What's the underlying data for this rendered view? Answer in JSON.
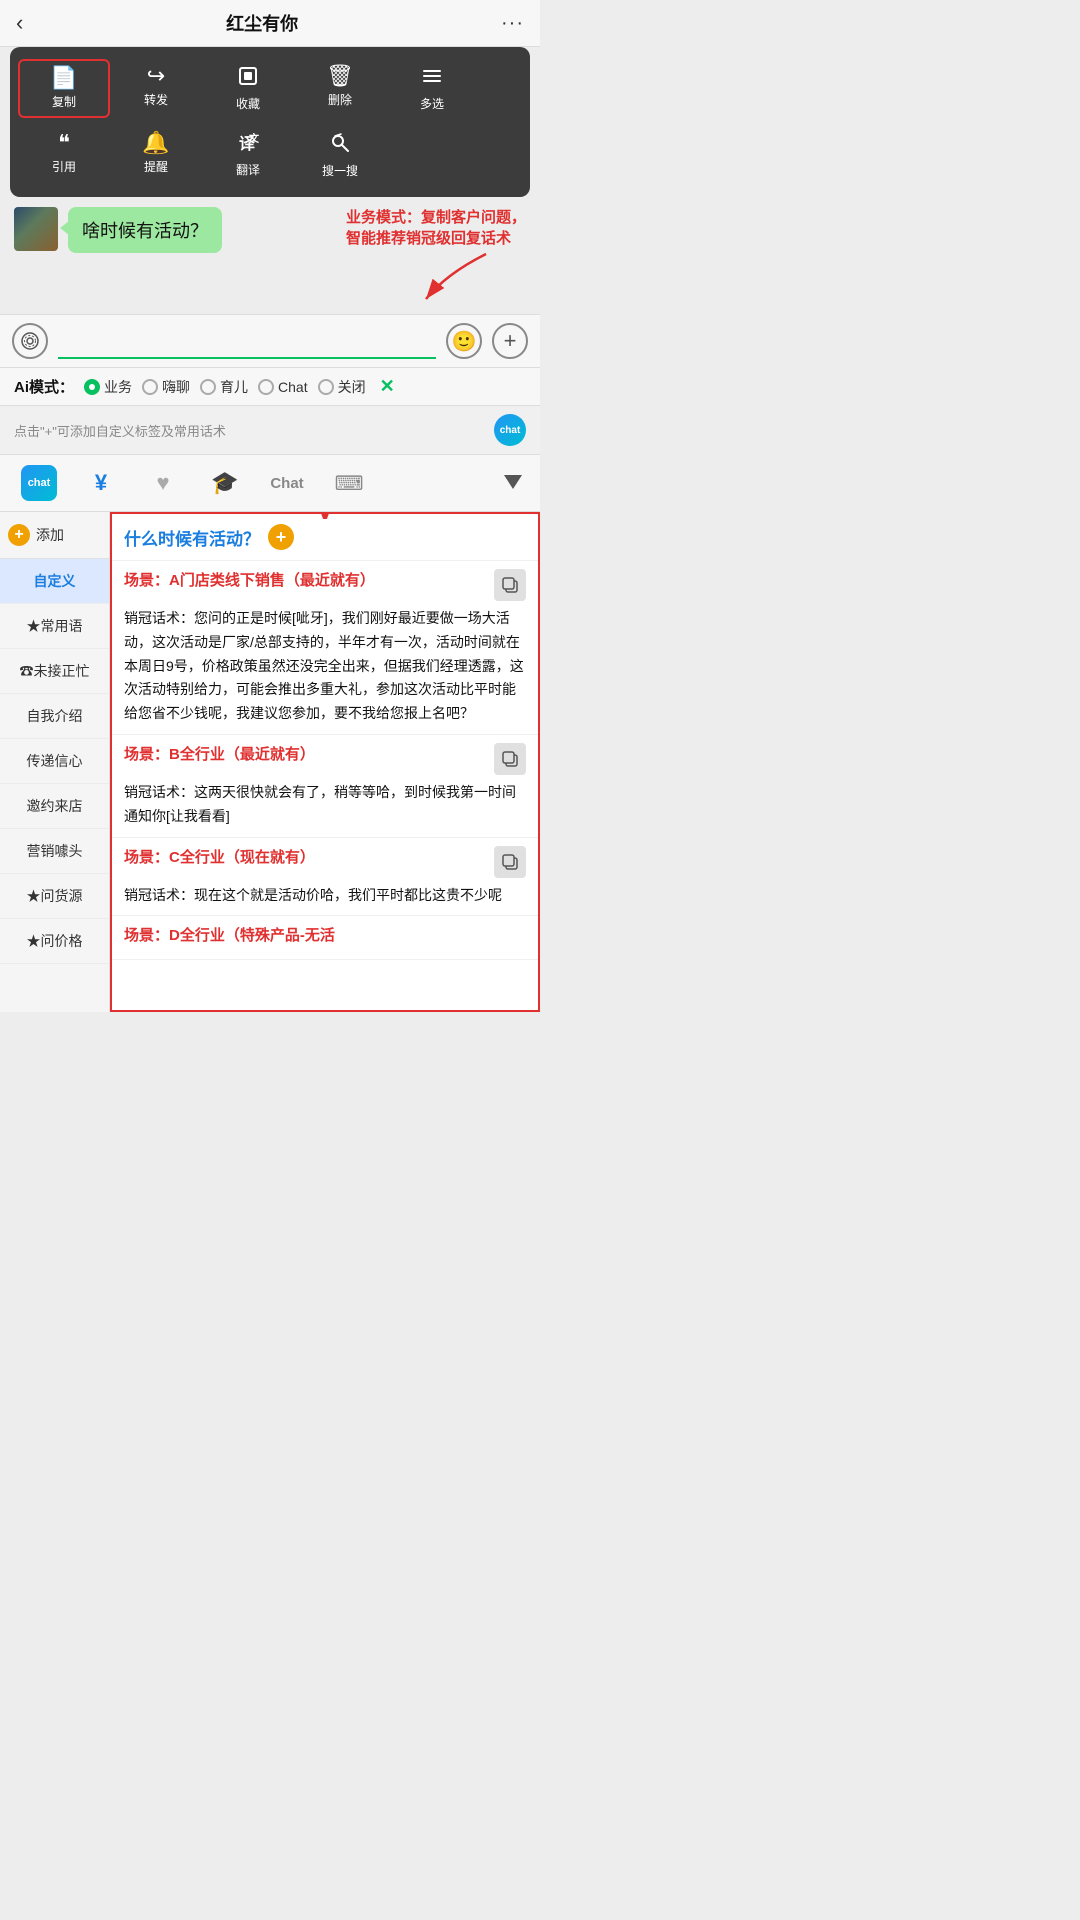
{
  "header": {
    "back_icon": "‹",
    "title": "红尘有你",
    "more_icon": "···"
  },
  "context_menu": {
    "row1": [
      {
        "icon": "📄",
        "label": "复制",
        "highlighted": true
      },
      {
        "icon": "↪",
        "label": "转发"
      },
      {
        "icon": "🎁",
        "label": "收藏"
      },
      {
        "icon": "🗑",
        "label": "删除"
      },
      {
        "icon": "☰",
        "label": "多选"
      }
    ],
    "row2": [
      {
        "icon": "❝",
        "label": "引用"
      },
      {
        "icon": "🔔",
        "label": "提醒"
      },
      {
        "icon": "译",
        "label": "翻译"
      },
      {
        "icon": "🔍",
        "label": "搜一搜"
      }
    ]
  },
  "chat": {
    "bubble_text": "啥时候有活动？"
  },
  "annotation": {
    "text": "业务模式：复制客户问题，\n智能推荐销冠级回复话术"
  },
  "input_bar": {
    "placeholder": ""
  },
  "ai_modes": {
    "label": "Ai模式：",
    "options": [
      {
        "label": "业务",
        "active": true
      },
      {
        "label": "嗨聊",
        "active": false
      },
      {
        "label": "育儿",
        "active": false
      },
      {
        "label": "Chat",
        "active": false
      },
      {
        "label": "关闭",
        "active": false
      }
    ]
  },
  "toolbar_hint": {
    "text": "点击\"+\"可添加自定义标签及常用话术",
    "chat_logo": "chat"
  },
  "tabs": [
    {
      "label": "chat",
      "type": "logo"
    },
    {
      "label": "¥",
      "active": false
    },
    {
      "label": "♥",
      "active": false
    },
    {
      "label": "🎓",
      "active": false
    },
    {
      "label": "Chat",
      "active": false
    },
    {
      "label": "⌨",
      "active": false
    }
  ],
  "sidebar": {
    "add_label": "添加",
    "items": [
      {
        "label": "自定义",
        "active": true
      },
      {
        "label": "★常用语"
      },
      {
        "label": "☎未接正忙"
      },
      {
        "label": "自我介绍"
      },
      {
        "label": "传递信心"
      },
      {
        "label": "邀约来店"
      },
      {
        "label": "营销噱头"
      },
      {
        "label": "★问货源"
      },
      {
        "label": "★问价格"
      }
    ]
  },
  "content": {
    "question": "什么时候有活动？",
    "scenarios": [
      {
        "title": "场景：A门店类线下销售（最近就有）",
        "body": "销冠话术：您问的正是时候[呲牙]，我们刚好最近要做一场大活动，这次活动是厂家/总部支持的，半年才有一次，活动时间就在本周日9号，价格政策虽然还没完全出来，但据我们经理透露，这次活动特别给力，可能会推出多重大礼，参加这次活动比平时能给您省不少钱呢，我建议您参加，要不我给您报上名吧？"
      },
      {
        "title": "场景：B全行业（最近就有）",
        "body": "销冠话术：这两天很快就会有了，稍等等哈，到时候我第一时间通知你[让我看看]"
      },
      {
        "title": "场景：C全行业（现在就有）",
        "body": "销冠话术：现在这个就是活动价哈，我们平时都比这贵不少呢"
      },
      {
        "title": "场景：D全行业（特殊产品-无活",
        "body": ""
      }
    ]
  }
}
